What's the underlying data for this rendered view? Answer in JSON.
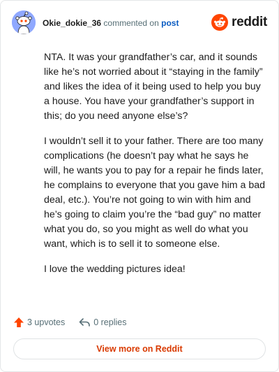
{
  "header": {
    "username": "Okie_dokie_36",
    "action_text": "commented on",
    "post_link": "post",
    "logo_text": "reddit"
  },
  "comment": {
    "paragraphs": [
      "NTA. It was your grandfather’s car, and it sounds like he’s not worried about it “staying in the family” and likes the idea of it being used to help you buy a house. You have your grandfather’s support in this; do you need anyone else’s?",
      "I wouldn’t sell it to your father. There are too many complications (he doesn’t pay what he says he will, he wants you to pay for a repair he finds later, he complains to everyone that you gave him a bad deal, etc.). You’re not going to win with him and he’s going to claim you’re the “bad guy” no matter what you do, so you might as well do what you want, which is to sell it to someone else.",
      "I love the wedding pictures idea!"
    ]
  },
  "actions": {
    "upvotes_label": "3 upvotes",
    "replies_label": "0 replies"
  },
  "footer": {
    "view_more_label": "View more on Reddit"
  },
  "colors": {
    "brand": "#ff4500",
    "link": "#0a5cc2",
    "view_more": "#d93a00"
  },
  "icons": {
    "avatar": "snoo-avatar",
    "logo": "reddit-logo-icon",
    "upvote": "upvote-arrow-icon",
    "reply": "reply-arrow-icon"
  }
}
